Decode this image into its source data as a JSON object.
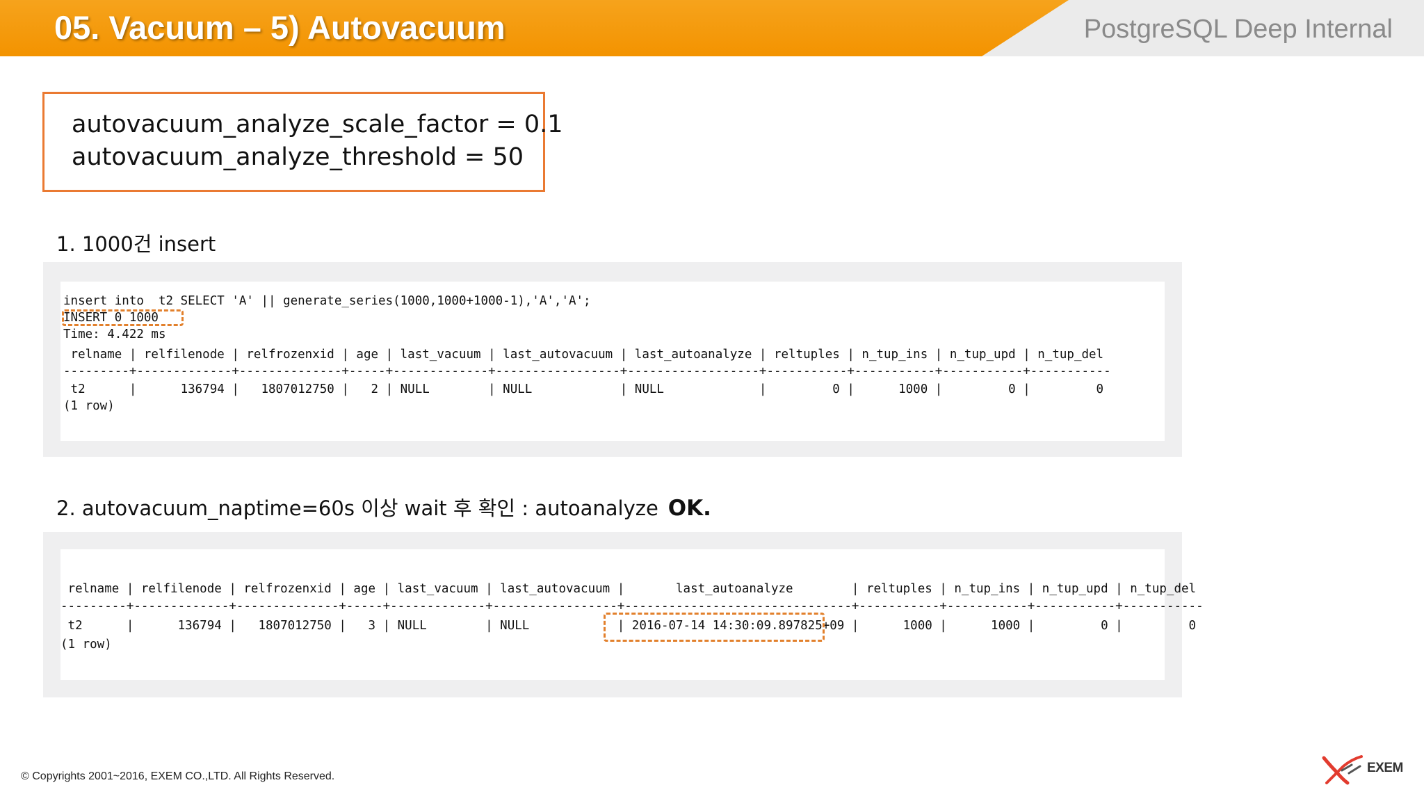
{
  "header": {
    "title": "05. Vacuum – 5) Autovacuum",
    "subtitle": "PostgreSQL Deep Internal"
  },
  "settings": [
    "autovacuum_analyze_scale_factor = 0.1",
    "autovacuum_analyze_threshold = 50"
  ],
  "step1": {
    "heading": "1. 1000건 insert",
    "lines": [
      "insert into  t2 SELECT 'A' || generate_series(1000,1000+1000-1),'A','A';",
      "INSERT 0 1000",
      "Time: 4.422 ms",
      " relname | relfilenode | relfrozenxid | age | last_vacuum | last_autovacuum | last_autoanalyze | reltuples | n_tup_ins | n_tup_upd | n_tup_del",
      "---------+-------------+--------------+-----+-------------+-----------------+------------------+-----------+-----------+-----------+-----------",
      " t2      |      136794 |   1807012750 |   2 | NULL        | NULL            | NULL             |         0 |      1000 |         0 |         0",
      "(1 row)"
    ]
  },
  "step2": {
    "heading": "2. autovacuum_naptime=60s 이상 wait 후 확인 : autoanalyze",
    "ok": "OK.",
    "lines": [
      " relname | relfilenode | relfrozenxid | age | last_vacuum | last_autovacuum |       last_autoanalyze        | reltuples | n_tup_ins | n_tup_upd | n_tup_del",
      "---------+-------------+--------------+-----+-------------+-----------------+-------------------------------+-----------+-----------+-----------+-----------",
      " t2      |      136794 |   1807012750 |   3 | NULL        | NULL            | 2016-07-14 14:30:09.897825+09 |      1000 |      1000 |         0 |         0",
      "(1 row)"
    ]
  },
  "footer": {
    "copyright": "© Copyrights 2001~2016, EXEM CO.,LTD. All Rights Reserved.",
    "logo_text": "EXEM"
  },
  "colors": {
    "accent_orange": "#f39300",
    "highlight_dashed": "#e2802c",
    "box_border": "#ea7a32"
  }
}
